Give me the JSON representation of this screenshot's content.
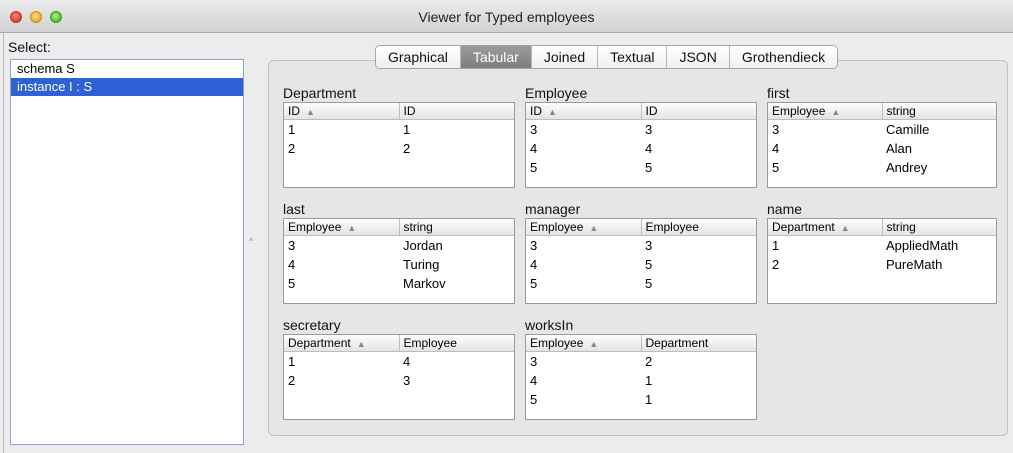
{
  "window": {
    "title": "Viewer for Typed employees"
  },
  "left": {
    "label": "Select:",
    "items": [
      {
        "text": "schema S",
        "selected": false
      },
      {
        "text": "instance I : S",
        "selected": true
      }
    ]
  },
  "tabs": [
    {
      "label": "Graphical",
      "active": false
    },
    {
      "label": "Tabular",
      "active": true
    },
    {
      "label": "Joined",
      "active": false
    },
    {
      "label": "Textual",
      "active": false
    },
    {
      "label": "JSON",
      "active": false
    },
    {
      "label": "Grothendieck",
      "active": false
    }
  ],
  "tables": [
    {
      "name": "Department",
      "columns": [
        "ID",
        "ID"
      ],
      "rows": [
        [
          "1",
          "1"
        ],
        [
          "2",
          "2"
        ]
      ]
    },
    {
      "name": "Employee",
      "columns": [
        "ID",
        "ID"
      ],
      "rows": [
        [
          "3",
          "3"
        ],
        [
          "4",
          "4"
        ],
        [
          "5",
          "5"
        ]
      ]
    },
    {
      "name": "first",
      "columns": [
        "Employee",
        "string"
      ],
      "rows": [
        [
          "3",
          "Camille"
        ],
        [
          "4",
          "Alan"
        ],
        [
          "5",
          "Andrey"
        ]
      ]
    },
    {
      "name": "last",
      "columns": [
        "Employee",
        "string"
      ],
      "rows": [
        [
          "3",
          "Jordan"
        ],
        [
          "4",
          "Turing"
        ],
        [
          "5",
          "Markov"
        ]
      ]
    },
    {
      "name": "manager",
      "columns": [
        "Employee",
        "Employee"
      ],
      "rows": [
        [
          "3",
          "3"
        ],
        [
          "4",
          "5"
        ],
        [
          "5",
          "5"
        ]
      ]
    },
    {
      "name": "name",
      "columns": [
        "Department",
        "string"
      ],
      "rows": [
        [
          "1",
          "AppliedMath"
        ],
        [
          "2",
          "PureMath"
        ]
      ]
    },
    {
      "name": "secretary",
      "columns": [
        "Department",
        "Employee"
      ],
      "rows": [
        [
          "1",
          "4"
        ],
        [
          "2",
          "3"
        ]
      ]
    },
    {
      "name": "worksIn",
      "columns": [
        "Employee",
        "Department"
      ],
      "rows": [
        [
          "3",
          "2"
        ],
        [
          "4",
          "1"
        ],
        [
          "5",
          "1"
        ]
      ]
    }
  ]
}
